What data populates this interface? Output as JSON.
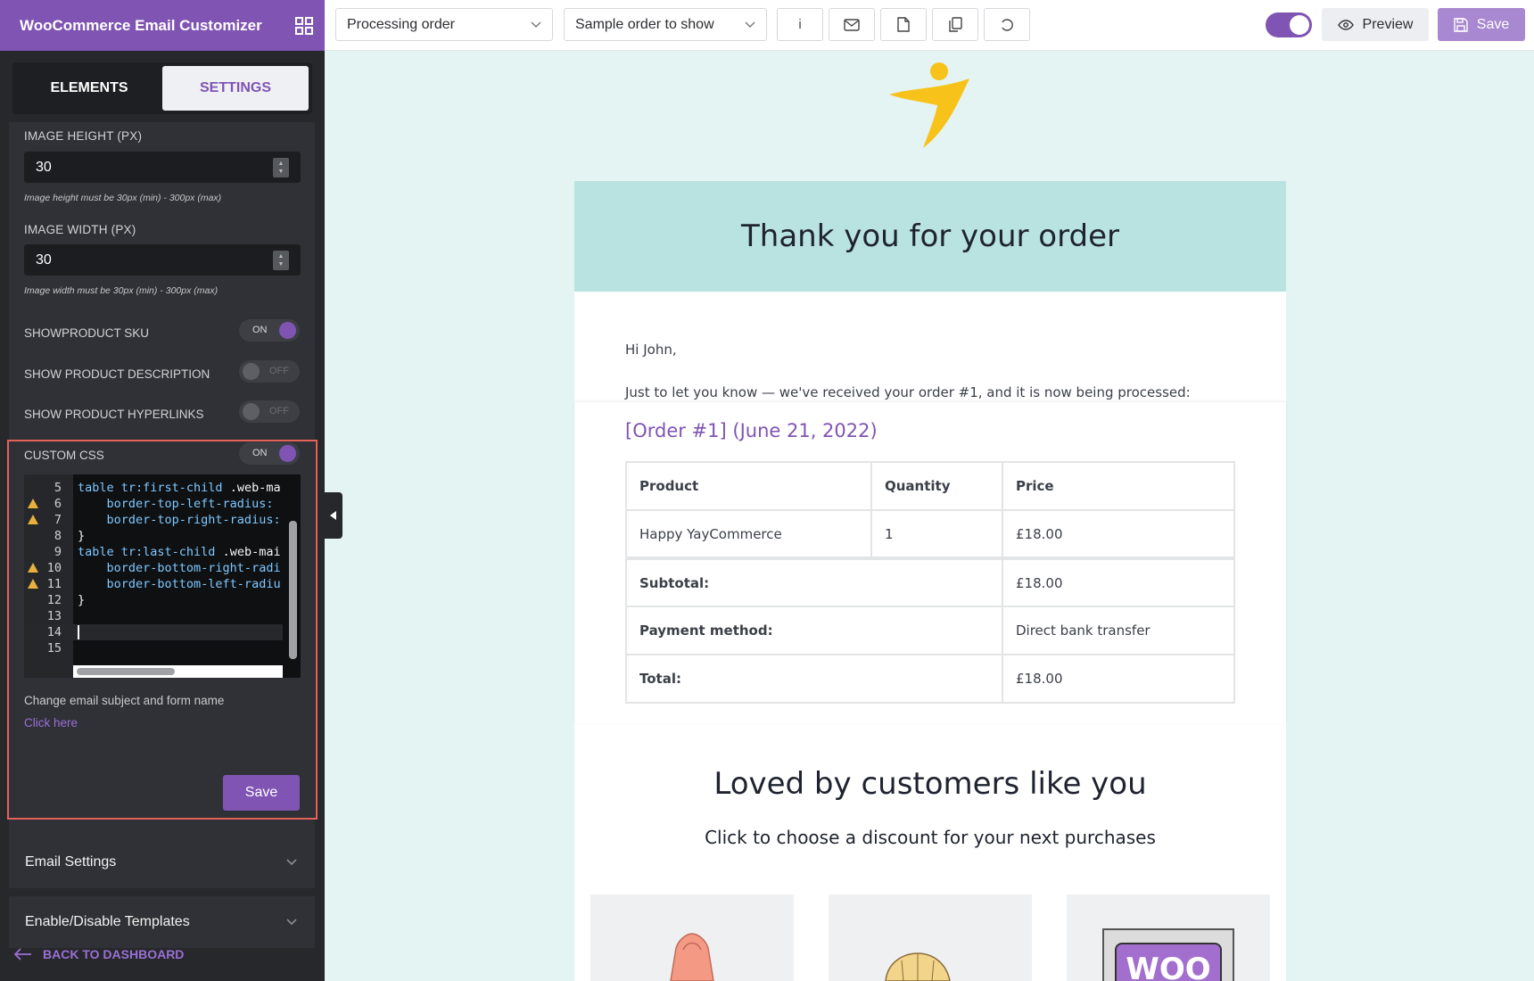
{
  "app": {
    "title": "WooCommerce Email Customizer"
  },
  "tabs": {
    "elements": "ELEMENTS",
    "settings": "SETTINGS"
  },
  "settings": {
    "image_height": {
      "label": "IMAGE HEIGHT (PX)",
      "value": "30",
      "hint": "Image height must be 30px (min) - 300px (max)"
    },
    "image_width": {
      "label": "IMAGE WIDTH (PX)",
      "value": "30",
      "hint": "Image width must be 30px (min) - 300px (max)"
    },
    "toggles": [
      {
        "label": "SHOWPRODUCT SKU",
        "state": "ON"
      },
      {
        "label": "SHOW PRODUCT DESCRIPTION",
        "state": "OFF"
      },
      {
        "label": "SHOW PRODUCT HYPERLINKS",
        "state": "OFF"
      }
    ],
    "custom_css": {
      "label": "CUSTOM CSS",
      "state": "ON"
    },
    "code_lines": [
      {
        "n": "5",
        "sel": "table tr:first-child",
        "rest": " .web-ma",
        "warn": false
      },
      {
        "n": "6",
        "text": "    border-top-left-radius:",
        "warn": true
      },
      {
        "n": "7",
        "text": "    border-top-right-radius:",
        "warn": true
      },
      {
        "n": "8",
        "text": "}",
        "warn": false
      },
      {
        "n": "9",
        "sel": "table tr:last-child",
        "rest": " .web-mai",
        "warn": false
      },
      {
        "n": "10",
        "text": "    border-bottom-right-radi",
        "warn": true
      },
      {
        "n": "11",
        "text": "    border-bottom-left-radiu",
        "warn": true
      },
      {
        "n": "12",
        "text": "}",
        "warn": false
      },
      {
        "n": "13",
        "text": "",
        "warn": false
      },
      {
        "n": "14",
        "text": "",
        "warn": false,
        "active": true
      },
      {
        "n": "15",
        "text": "",
        "warn": false
      }
    ],
    "change_text": "Change email subject and form name",
    "click_here": "Click here",
    "save": "Save"
  },
  "accordions": {
    "email_settings": "Email Settings",
    "templates": "Enable/Disable Templates"
  },
  "back": "BACK TO DASHBOARD",
  "topbar": {
    "template_select": "Processing order",
    "sample_select": "Sample order to show",
    "info_icon_label": "i",
    "preview": "Preview",
    "save": "Save"
  },
  "email": {
    "heading": "Thank you for your order",
    "greeting": "Hi John,",
    "intro": "Just to let you know — we've received your order #1, and it is now being processed:",
    "order_title": "[Order #1] (June 21, 2022)",
    "table": {
      "headers": [
        "Product",
        "Quantity",
        "Price"
      ],
      "item": {
        "product": "Happy YayCommerce",
        "qty": "1",
        "price": "£18.00"
      },
      "totals": [
        {
          "label": "Subtotal:",
          "value": "£18.00"
        },
        {
          "label": "Payment method:",
          "value": "Direct bank transfer"
        },
        {
          "label": "Total:",
          "value": "£18.00"
        }
      ]
    },
    "loved_title": "Loved by customers like you",
    "loved_sub": "Click to choose a discount for your next purchases",
    "promo_text": "WOO"
  },
  "colors": {
    "brand": "#7f54b3",
    "sidebar": "#26282b",
    "header_band": "#b9e3e1",
    "canvas": "#e4f4f2",
    "logo_yellow": "#f7c31a"
  }
}
